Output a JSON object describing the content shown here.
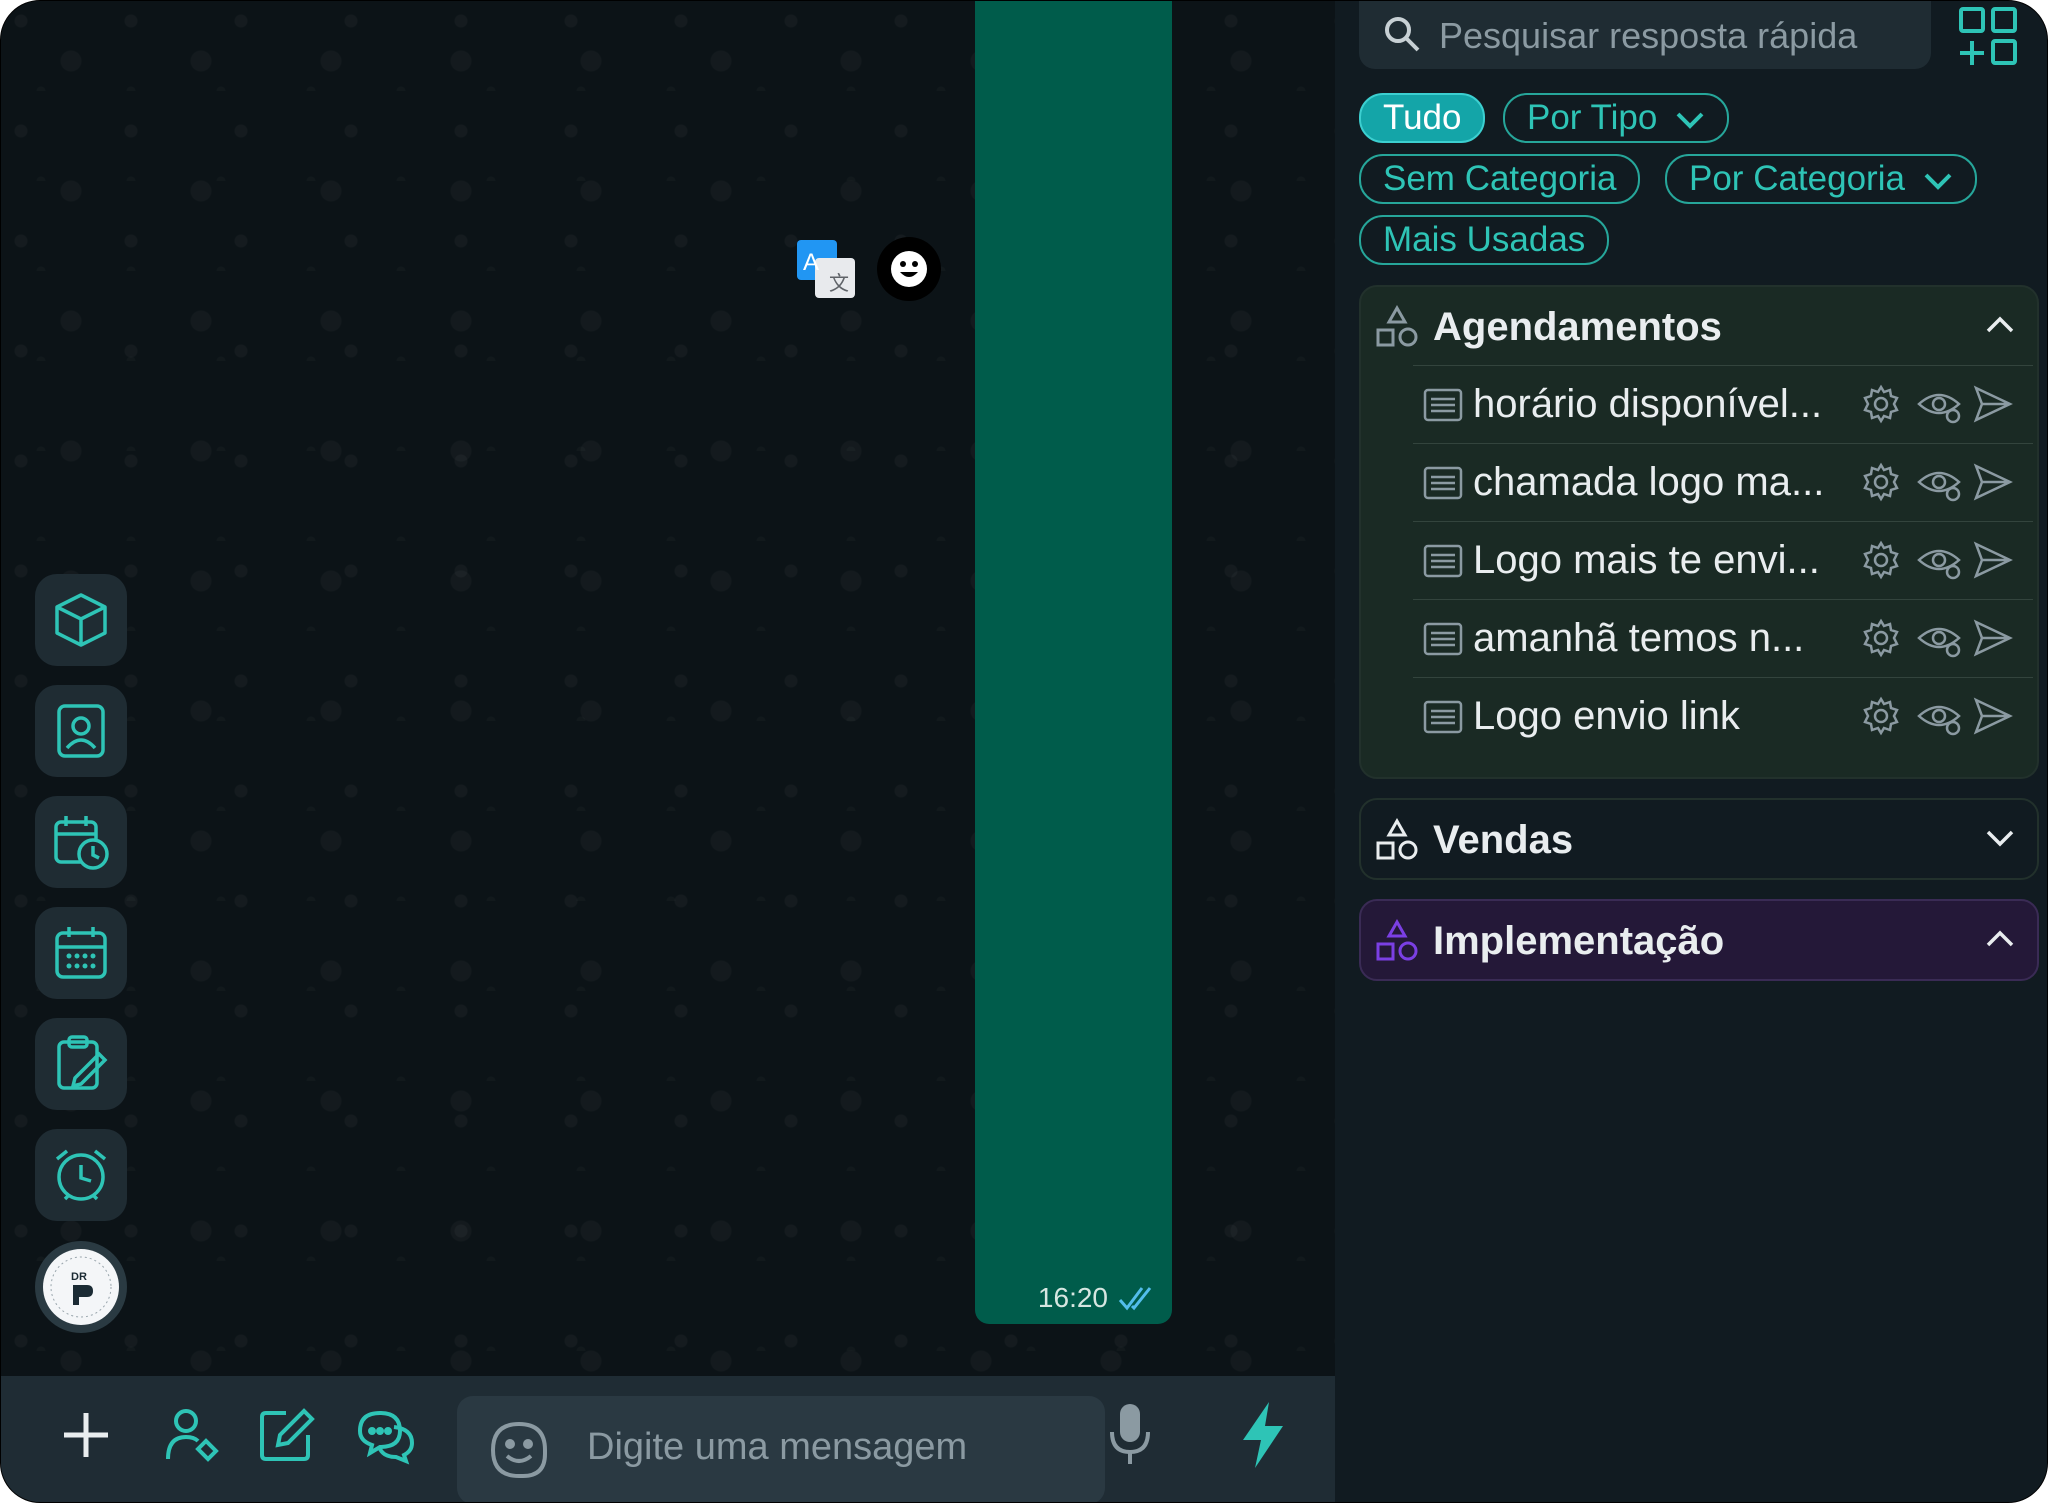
{
  "chat": {
    "message_time": "16:20",
    "input_placeholder": "Digite uma mensagem"
  },
  "side_rail": {
    "items": [
      "cube-icon",
      "contact-card-icon",
      "calendar-clock-icon",
      "calendar-icon",
      "clipboard-edit-icon",
      "alarm-clock-icon",
      "logo"
    ]
  },
  "bottom_bar": {
    "icons": [
      "plus-icon",
      "user-tag-icon",
      "edit-icon",
      "chat-bubbles-icon",
      "microphone-icon",
      "lightning-icon"
    ]
  },
  "quick_replies": {
    "search_placeholder": "Pesquisar resposta rápida",
    "filters": {
      "all": "Tudo",
      "by_type": "Por Tipo",
      "no_category": "Sem Categoria",
      "by_category": "Por Categoria",
      "most_used": "Mais Usadas"
    },
    "categories": [
      {
        "title": "Agendamentos",
        "expanded": true,
        "items": [
          "horário disponível...",
          "chamada logo ma...",
          "Logo mais te envi...",
          "amanhã temos n...",
          "Logo envio link"
        ]
      },
      {
        "title": "Vendas",
        "expanded": false
      },
      {
        "title": "Implementação",
        "expanded": true,
        "color": "#7b3fe4"
      }
    ]
  },
  "colors": {
    "accent": "#2ec4b6",
    "bubble": "#005c4b",
    "panel": "#111b21"
  }
}
